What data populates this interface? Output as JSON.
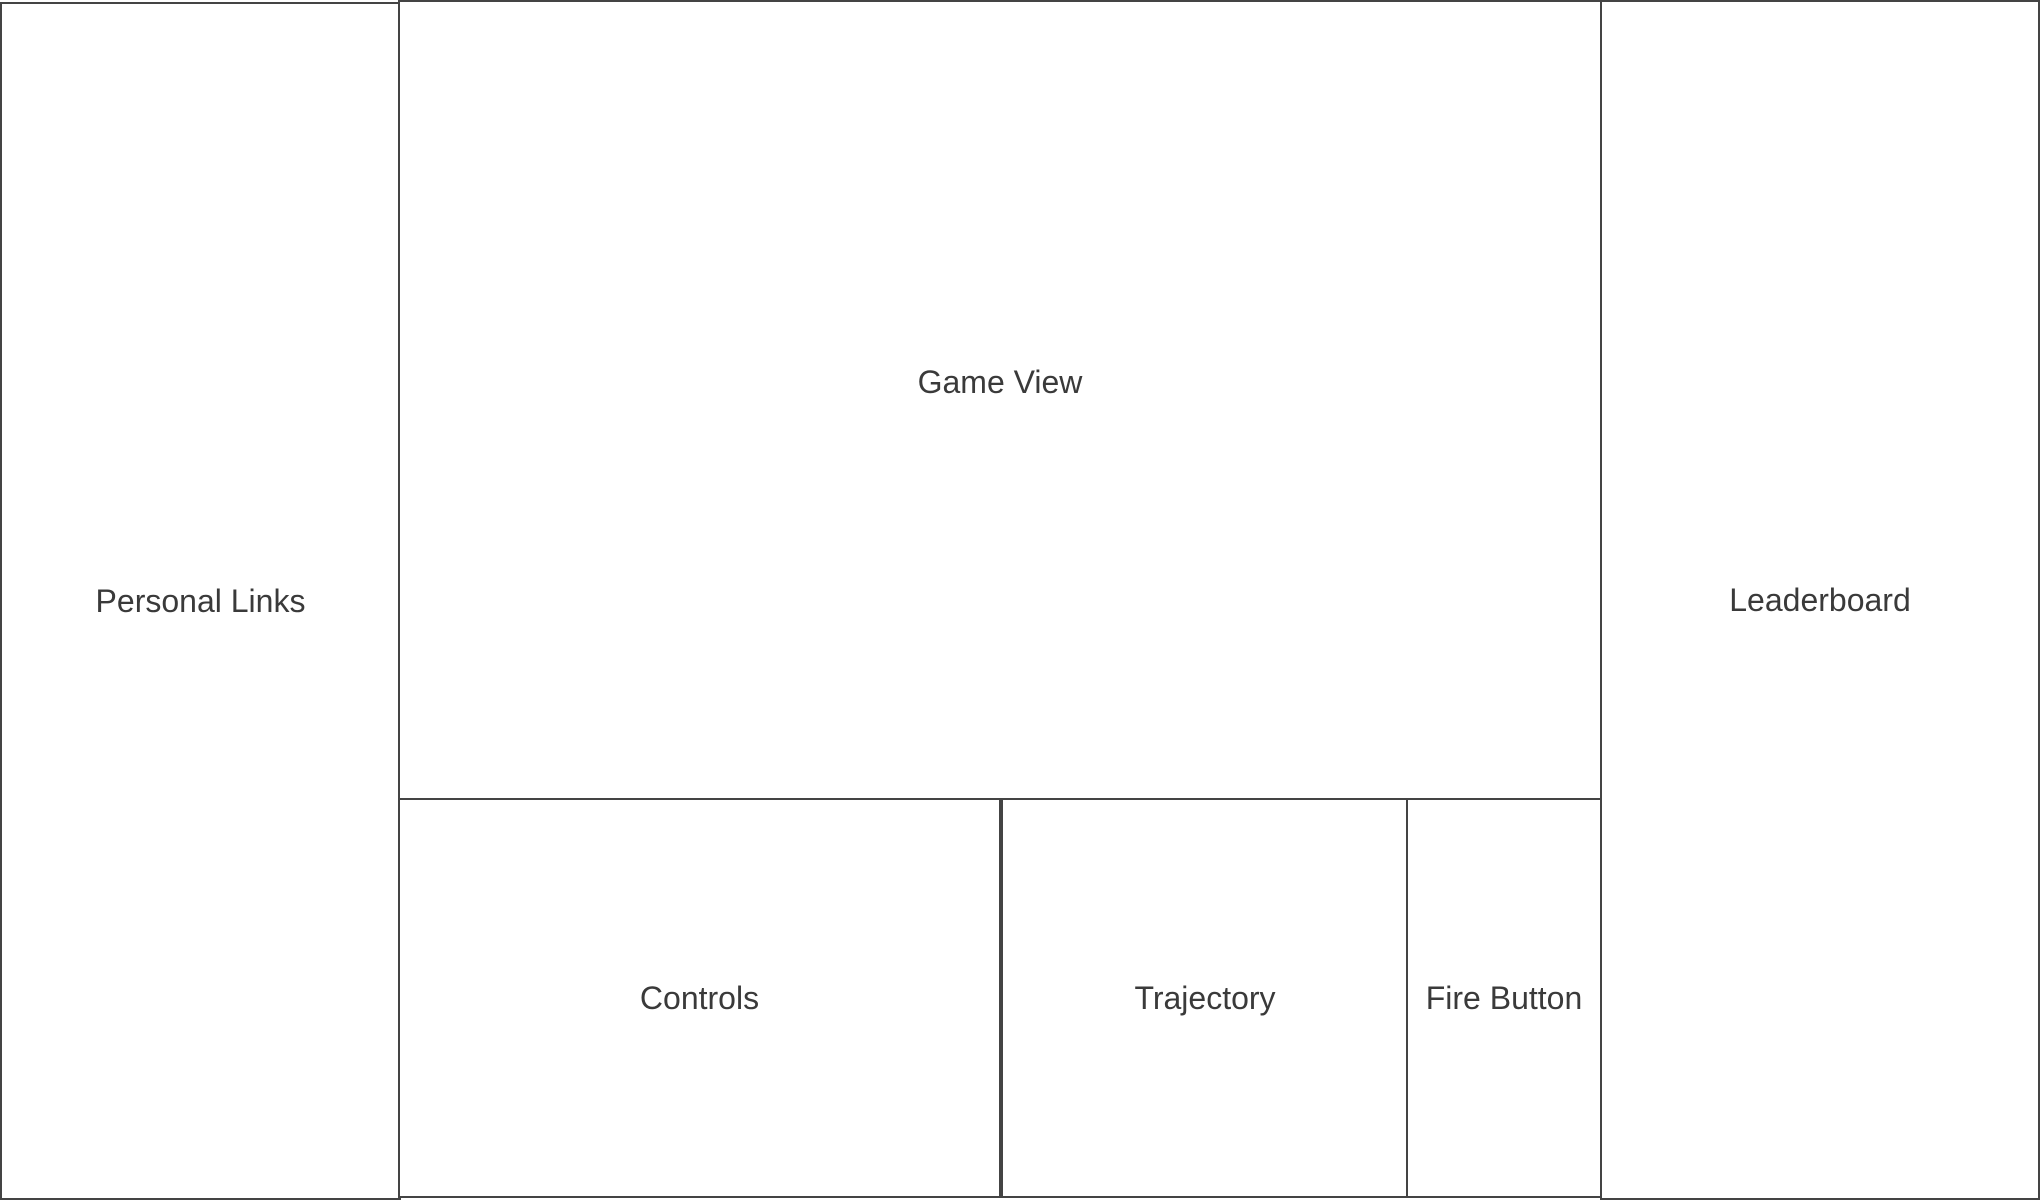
{
  "panels": {
    "personal_links": "Personal Links",
    "game_view": "Game View",
    "controls": "Controls",
    "trajectory": "Trajectory",
    "fire_button": "Fire Button",
    "leaderboard": "Leaderboard"
  },
  "colors": {
    "border": "#444444",
    "text": "#3a3a3a",
    "background": "#ffffff"
  }
}
